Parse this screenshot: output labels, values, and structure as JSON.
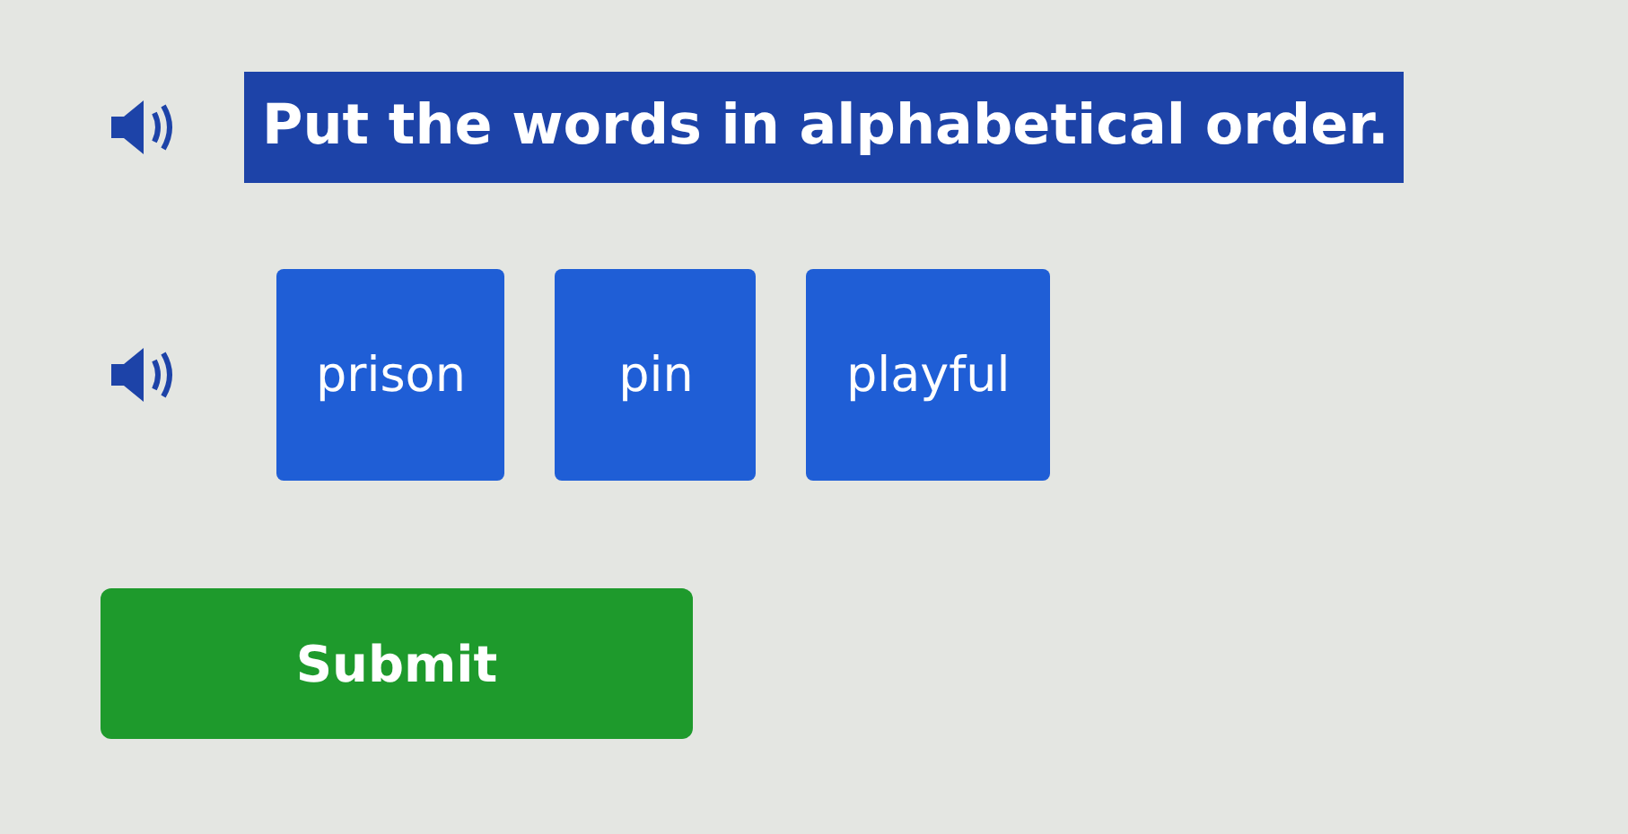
{
  "prompt": {
    "text": "Put the words in alphabetical order."
  },
  "words": [
    {
      "label": "prison"
    },
    {
      "label": "pin"
    },
    {
      "label": "playful"
    }
  ],
  "submit": {
    "label": "Submit"
  }
}
